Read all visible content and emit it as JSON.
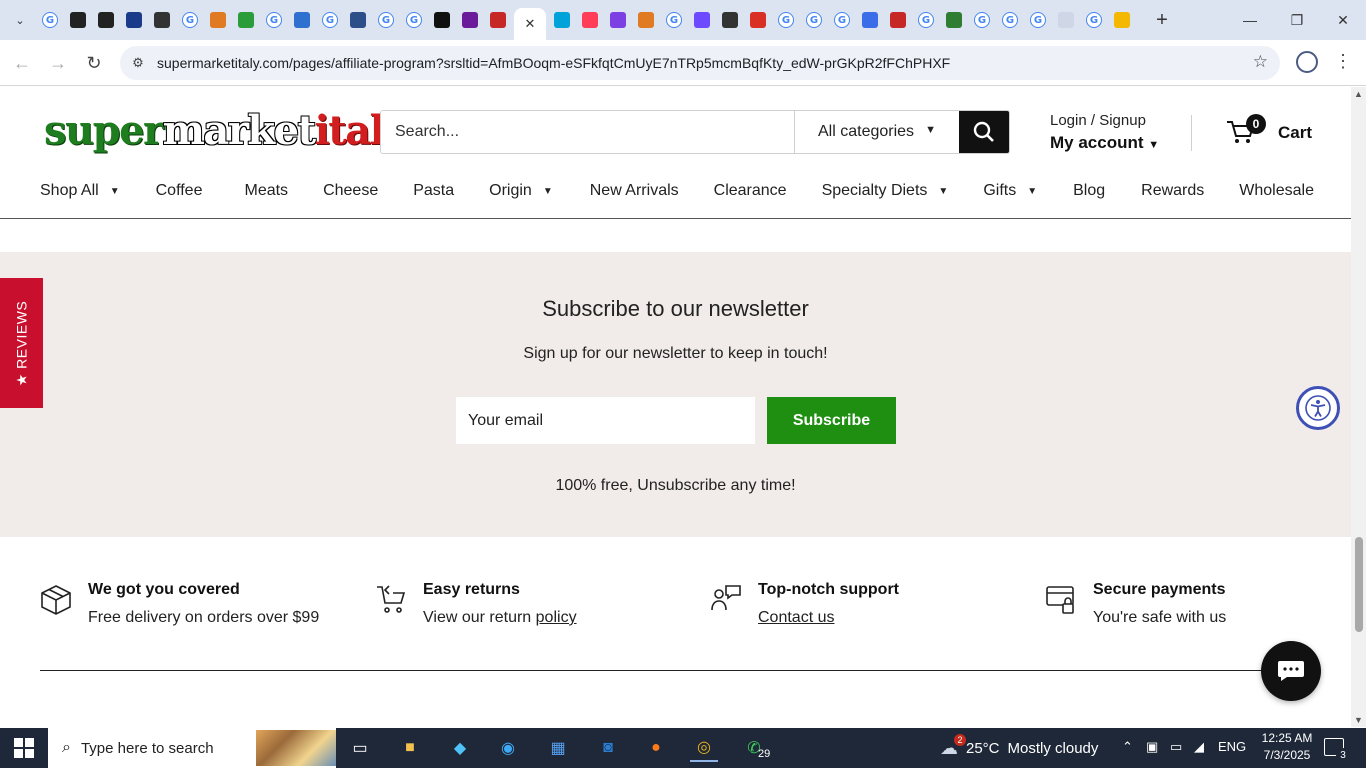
{
  "browser": {
    "url": "supermarketitaly.com/pages/affiliate-program?srsltid=AfmBOoqm-eSFkfqtCmUyE7nTRp5mcmBqfKty_edW-prGKpR2fFChPHXF",
    "tab_favicons": [
      "google-icon",
      "chatgpt-icon",
      "chatgpt-icon",
      "ttp-icon",
      "b-icon",
      "google-icon",
      "app-icon",
      "globe-icon",
      "google-icon",
      "xf-icon",
      "google-icon",
      "book-icon",
      "google-icon",
      "google-icon",
      "movie-icon",
      "c-icon",
      "recipe-icon",
      "active-tab",
      "w-icon",
      "monday-icon",
      "edge-icon",
      "app-icon",
      "google-icon",
      "proton-icon",
      "b-icon",
      "gmail-icon",
      "google-icon",
      "google-icon",
      "google-icon",
      "copilot-icon",
      "red-icon",
      "google-icon",
      "green-icon",
      "google-icon",
      "google-icon",
      "google-icon",
      "blank-icon",
      "google-icon",
      "yellow-icon"
    ]
  },
  "header": {
    "logo": {
      "part1": "super",
      "part2": "market",
      "part3": "italy"
    },
    "search_placeholder": "Search...",
    "category": "All categories",
    "login": "Login / Signup",
    "account": "My account",
    "cart_count": "0",
    "cart_label": "Cart"
  },
  "menu": [
    {
      "label": "Shop All",
      "dropdown": true
    },
    {
      "label": "Coffee",
      "dropdown": false
    },
    {
      "label": "Meats",
      "dropdown": false
    },
    {
      "label": "Cheese",
      "dropdown": false
    },
    {
      "label": "Pasta",
      "dropdown": false
    },
    {
      "label": "Origin",
      "dropdown": true
    },
    {
      "label": "New Arrivals",
      "dropdown": false
    },
    {
      "label": "Clearance",
      "dropdown": false
    },
    {
      "label": "Specialty Diets",
      "dropdown": true
    },
    {
      "label": "Gifts",
      "dropdown": true
    },
    {
      "label": "Blog",
      "dropdown": false
    },
    {
      "label": "Rewards",
      "dropdown": false
    },
    {
      "label": "Wholesale",
      "dropdown": false
    }
  ],
  "newsletter": {
    "title": "Subscribe to our newsletter",
    "subtitle": "Sign up for our newsletter to keep in touch!",
    "email_placeholder": "Your email",
    "button": "Subscribe",
    "note": "100% free, Unsubscribe any time!"
  },
  "reviews_tab": "★ REVIEWS",
  "features": [
    {
      "title": "We got you covered",
      "desc": "Free delivery on orders over $99",
      "link": ""
    },
    {
      "title": "Easy returns",
      "desc": "View our return ",
      "link": "policy"
    },
    {
      "title": "Top-notch support",
      "desc": "",
      "link": "Contact us"
    },
    {
      "title": "Secure payments",
      "desc": "You're safe with us",
      "link": ""
    }
  ],
  "taskbar": {
    "search_placeholder": "Type here to search",
    "whatsapp_badge": "29",
    "weather_badge": "2",
    "temperature": "25°C",
    "weather": "Mostly cloudy",
    "language": "ENG",
    "time": "12:25 AM",
    "date": "7/3/2025",
    "notifications": "3"
  },
  "colors": {
    "brand_green": "#1f8f12",
    "reviews_red": "#c8102e",
    "newsletter_bg": "#f1ebe9"
  }
}
